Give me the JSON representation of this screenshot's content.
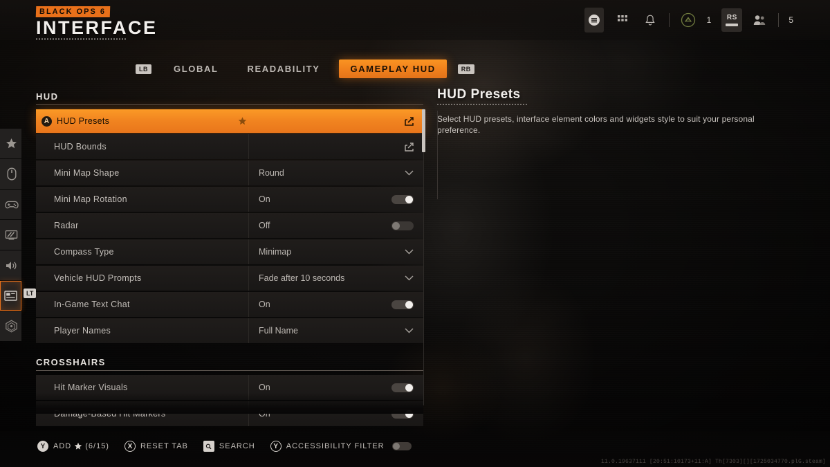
{
  "app": {
    "brand_tag": "BLACK OPS 6",
    "page_title": "INTERFACE",
    "accent_color": "#f0801c",
    "build_string": "11.0.19637111 [20:51:10173+11:A] Th[7303][][1725034770.plG.steam]"
  },
  "topbar": {
    "menu_icon": "hamburger-menu-icon",
    "apps_icon": "grid-apps-icon",
    "notifications_icon": "bell-icon",
    "currency_icon": "cod-points-icon",
    "currency_value": "1",
    "button_hint": "RS",
    "party_icon": "party-members-icon",
    "party_count": "5"
  },
  "tabs": {
    "left_bumper": "LB",
    "right_bumper": "RB",
    "items": [
      {
        "label": "GLOBAL",
        "active": false
      },
      {
        "label": "READABILITY",
        "active": false
      },
      {
        "label": "GAMEPLAY HUD",
        "active": true
      }
    ]
  },
  "rail": {
    "lt_hint": "LT",
    "items": [
      {
        "name": "favorites",
        "icon": "star-icon",
        "active": false
      },
      {
        "name": "mouse-keyboard",
        "icon": "mouse-icon",
        "active": false
      },
      {
        "name": "controller",
        "icon": "gamepad-icon",
        "active": false
      },
      {
        "name": "graphics",
        "icon": "monitor-icon",
        "active": false
      },
      {
        "name": "audio",
        "icon": "speaker-icon",
        "active": false
      },
      {
        "name": "interface",
        "icon": "interface-panel-icon",
        "active": true
      },
      {
        "name": "accessibility",
        "icon": "radar-accessibility-icon",
        "active": false
      }
    ]
  },
  "settings": {
    "sections": [
      {
        "title": "HUD",
        "rows": [
          {
            "label": "HUD Presets",
            "value": "",
            "control": "link",
            "selected": true,
            "favorited": true,
            "button_hint": "A"
          },
          {
            "label": "HUD Bounds",
            "value": "",
            "control": "link",
            "selected": false,
            "favorited": false
          },
          {
            "label": "Mini Map Shape",
            "value": "Round",
            "control": "dropdown",
            "selected": false,
            "favorited": false
          },
          {
            "label": "Mini Map Rotation",
            "value": "On",
            "control": "toggle",
            "toggle_state": "on",
            "selected": false,
            "favorited": false
          },
          {
            "label": "Radar",
            "value": "Off",
            "control": "toggle",
            "toggle_state": "off",
            "selected": false,
            "favorited": false
          },
          {
            "label": "Compass Type",
            "value": "Minimap",
            "control": "dropdown",
            "selected": false,
            "favorited": false
          },
          {
            "label": "Vehicle HUD Prompts",
            "value": "Fade after 10 seconds",
            "control": "dropdown",
            "selected": false,
            "favorited": false
          },
          {
            "label": "In-Game Text Chat",
            "value": "On",
            "control": "toggle",
            "toggle_state": "on",
            "selected": false,
            "favorited": false
          },
          {
            "label": "Player Names",
            "value": "Full Name",
            "control": "dropdown",
            "selected": false,
            "favorited": false
          }
        ]
      },
      {
        "title": "CROSSHAIRS",
        "rows": [
          {
            "label": "Hit Marker Visuals",
            "value": "On",
            "control": "toggle",
            "toggle_state": "on",
            "selected": false,
            "favorited": false
          },
          {
            "label": "Damage-Based Hit Markers",
            "value": "On",
            "control": "toggle",
            "toggle_state": "on",
            "selected": false,
            "favorited": false
          }
        ]
      }
    ]
  },
  "detail": {
    "title": "HUD Presets",
    "description": "Select HUD presets, interface element colors and widgets style to suit your personal preference."
  },
  "footer": {
    "hints": [
      {
        "badge": "Y",
        "badge_style": "filled",
        "label": "ADD",
        "star": true,
        "count": "(6/15)",
        "toggle": null
      },
      {
        "badge": "X",
        "badge_style": "ring",
        "label": "RESET TAB",
        "star": false,
        "count": "",
        "toggle": null
      },
      {
        "badge": "",
        "badge_style": "square",
        "label": "SEARCH",
        "star": false,
        "count": "",
        "toggle": null
      },
      {
        "badge": "Y",
        "badge_style": "ring",
        "label": "ACCESSIBILITY FILTER",
        "star": false,
        "count": "",
        "toggle": "off"
      }
    ]
  }
}
